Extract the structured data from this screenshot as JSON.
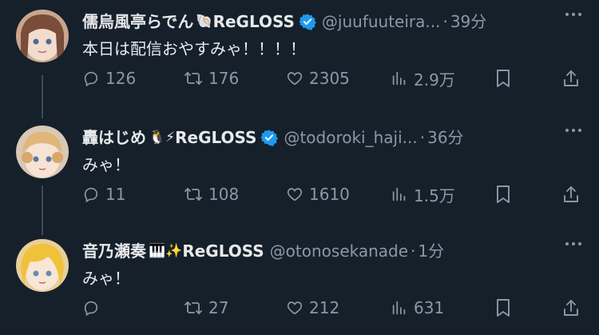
{
  "tweets": [
    {
      "name": "儒烏風亭らでん",
      "emoji": "🐚",
      "group": "ReGLOSS",
      "handle": "@juufuuteira...",
      "separator": "·",
      "time": "39分",
      "text": "本日は配信おやすみゃ！！！！",
      "stats": {
        "replies": "126",
        "retweets": "176",
        "likes": "2305",
        "views": "2.9万"
      }
    },
    {
      "name": "轟はじめ",
      "emoji": "🐧⚡",
      "group": "ReGLOSS",
      "handle": "@todoroki_haji...",
      "separator": "·",
      "time": "36分",
      "text": "みゃ！",
      "stats": {
        "replies": "11",
        "retweets": "108",
        "likes": "1610",
        "views": "1.5万"
      }
    },
    {
      "name": "音乃瀬奏",
      "emoji": "🎹✨",
      "group": "ReGLOSS",
      "handle": "@otonosekanade",
      "separator": "·",
      "time": "1分",
      "text": "みゃ！",
      "stats": {
        "replies": "",
        "retweets": "27",
        "likes": "212",
        "views": "631"
      }
    }
  ],
  "icons": [
    "reply-icon",
    "retweet-icon",
    "like-icon",
    "views-icon",
    "bookmark-icon",
    "share-icon",
    "verified-badge-icon"
  ],
  "colors": {
    "background": "#15202b",
    "text": "#e7e9ea",
    "muted": "#8b98a5",
    "verified": "#1d9bf0"
  }
}
